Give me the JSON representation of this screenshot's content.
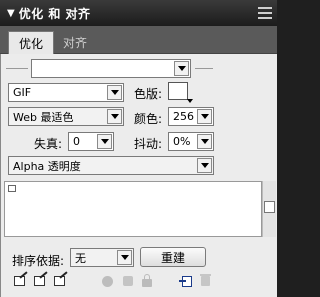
{
  "panel": {
    "title": "优化 和 对齐",
    "collapse_glyph": "▼"
  },
  "tabs": [
    {
      "label": "优化",
      "active": true
    },
    {
      "label": "对齐",
      "active": false
    }
  ],
  "settings": {
    "preset_value": "",
    "format_value": "GIF",
    "palette_value": "Web 最适色",
    "matte_label": "色版:",
    "colors_label": "颜色:",
    "colors_value": "256",
    "loss_label": "失真:",
    "loss_value": "0",
    "dither_label": "抖动:",
    "dither_value": "0%",
    "transparency_value": "Alpha 透明度"
  },
  "palette": {
    "sort_label": "排序依据:",
    "sort_value": "无",
    "rebuild_label": "重建"
  },
  "icons": [
    "edit-color-icon",
    "lock-edit-icon",
    "snap-edit-icon",
    "transparency-circle-icon",
    "square-icon",
    "lock-icon",
    "add-color-icon",
    "delete-color-icon"
  ],
  "colors": {
    "header_bg": "#1c1c1c",
    "panel_bg": "#ececec",
    "tab_active": "#e9e9e9"
  }
}
